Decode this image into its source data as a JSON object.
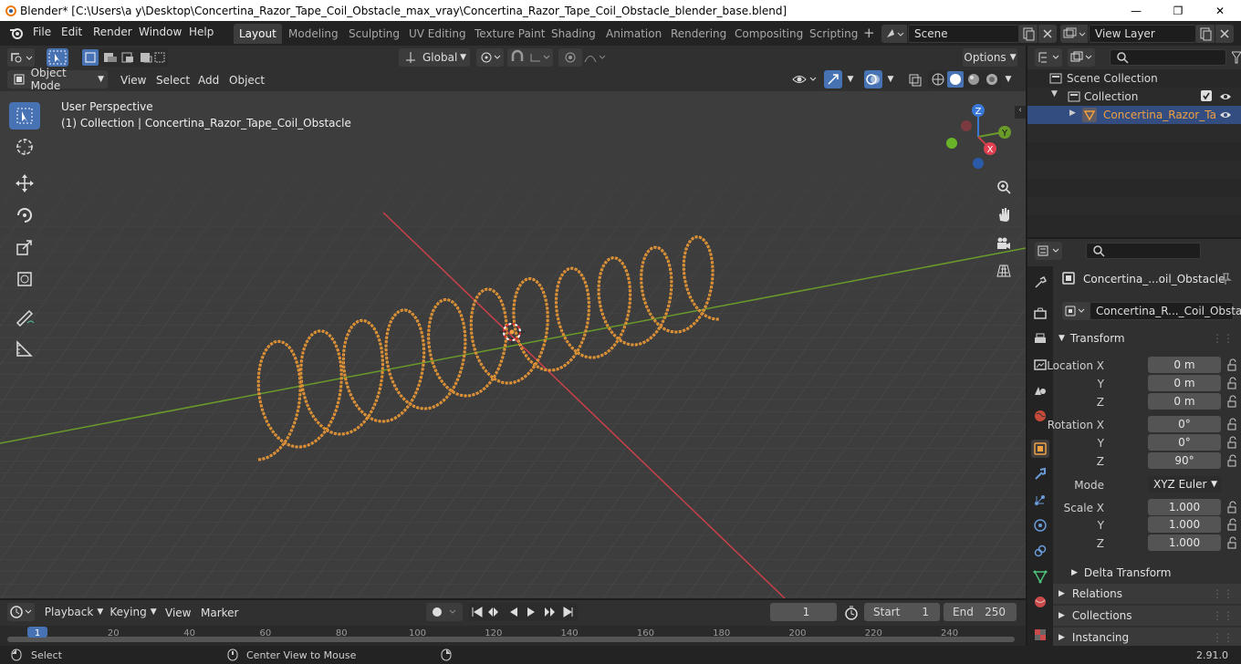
{
  "window": {
    "title": "Blender* [C:\\Users\\a y\\Desktop\\Concertina_Razor_Tape_Coil_Obstacle_max_vray\\Concertina_Razor_Tape_Coil_Obstacle_blender_base.blend]",
    "minimize": "—",
    "maximize": "❐",
    "close": "✕"
  },
  "menus": [
    "File",
    "Edit",
    "Render",
    "Window",
    "Help"
  ],
  "workspaces": [
    "Layout",
    "Modeling",
    "Sculpting",
    "UV Editing",
    "Texture Paint",
    "Shading",
    "Animation",
    "Rendering",
    "Compositing",
    "Scripting"
  ],
  "active_workspace": "Layout",
  "scene": "Scene",
  "view_layer": "View Layer",
  "tool_header": {
    "orientation": "Global",
    "options": "Options"
  },
  "viewport_header": {
    "mode": "Object Mode",
    "menus": [
      "View",
      "Select",
      "Add",
      "Object"
    ]
  },
  "viewport": {
    "perspective": "User Perspective",
    "collection_info": "(1) Collection | Concertina_Razor_Tape_Coil_Obstacle",
    "gizmo": {
      "x": "X",
      "y": "Y",
      "z": "Z"
    },
    "axis_colors": {
      "x": "#c8404a",
      "y": "#6a9a2a",
      "z": "#3a78d8"
    },
    "object_color": "#f0a040"
  },
  "outliner": {
    "items": [
      "Scene Collection",
      "Collection",
      "Concertina_Razor_Ta"
    ]
  },
  "properties": {
    "object_name": "Concertina_...oil_Obstacle",
    "data_name": "Concertina_R..._Coil_Obstacle",
    "transform_title": "Transform",
    "location": {
      "label": "Location X",
      "x": "0 m",
      "y": "0 m",
      "z": "0 m"
    },
    "rotation": {
      "label": "Rotation X",
      "x": "0°",
      "y": "0°",
      "z": "90°"
    },
    "mode_label": "Mode",
    "mode": "XYZ Euler",
    "scale": {
      "label": "Scale X",
      "x": "1.000",
      "y": "1.000",
      "z": "1.000"
    },
    "axis_y": "Y",
    "axis_z": "Z",
    "sections": [
      "Delta Transform",
      "Relations",
      "Collections",
      "Instancing"
    ]
  },
  "timeline": {
    "menus": [
      "Playback",
      "Keying",
      "View",
      "Marker"
    ],
    "current_frame": "1",
    "start_label": "Start",
    "start": "1",
    "end_label": "End",
    "end": "250",
    "ruler": [
      "1",
      "20",
      "40",
      "60",
      "80",
      "100",
      "120",
      "140",
      "160",
      "180",
      "200",
      "220",
      "240"
    ]
  },
  "status": {
    "select": "Select",
    "center": "Center View to Mouse",
    "version": "2.91.0"
  }
}
